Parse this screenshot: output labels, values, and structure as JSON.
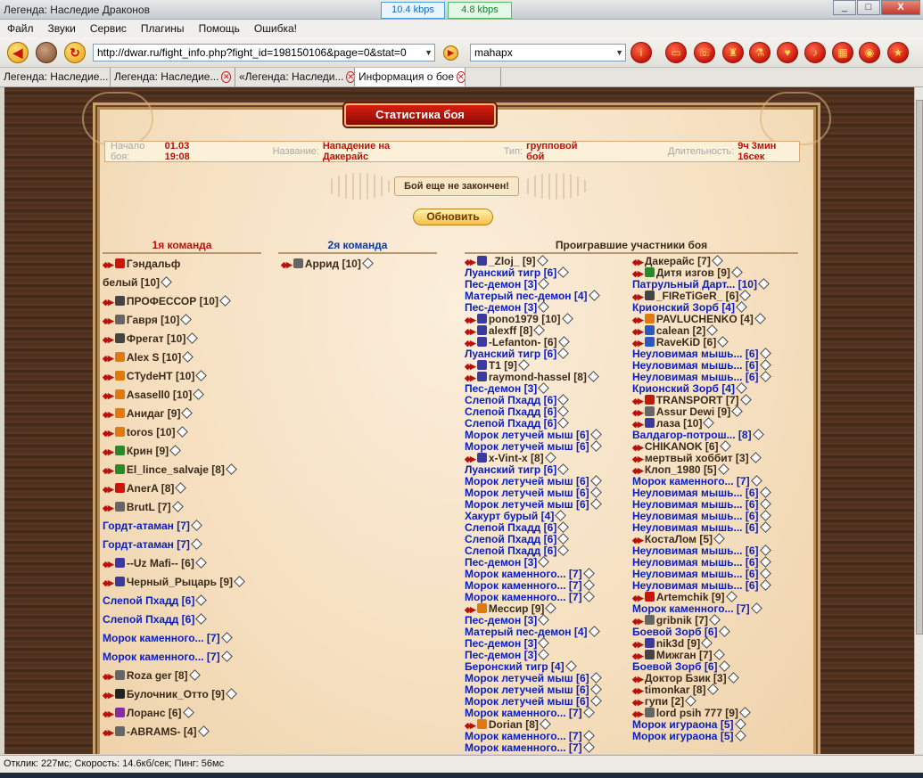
{
  "window": {
    "title": "Легенда: Наследие Драконов",
    "speed_down": "10.4 kbps",
    "speed_up": "4.8 kbps",
    "min": "_",
    "max": "□",
    "close": "X"
  },
  "menu": [
    "Файл",
    "Звуки",
    "Сервис",
    "Плагины",
    "Помощь",
    "Ошибка!"
  ],
  "toolbar": {
    "url": "http://dwar.ru/fight_info.php?fight_id=198150106&page=0&stat=0",
    "search": "mahapx"
  },
  "tabs": [
    {
      "label": "Легенда: Наследие..."
    },
    {
      "label": "Легенда: Наследие..."
    },
    {
      "label": "«Легенда: Наследи..."
    },
    {
      "label": "Информация о бое"
    }
  ],
  "page": {
    "header": "Статистика боя",
    "start_label": "Начало боя:",
    "start_value": "01.03 19:08",
    "name_label": "Название:",
    "name_value": "Нападение на Дакерайс",
    "type_label": "Тип:",
    "type_value": "групповой бой",
    "duration_label": "Длительность:",
    "duration_value": "9ч 3мин 16сек",
    "notice": "Бой еще не закончен!",
    "refresh": "Обновить",
    "team1_title": "1я команда",
    "team2_title": "2я команда",
    "lost_title": "Проигравшие участники боя"
  },
  "team1": [
    {
      "name": "Гэндальф",
      "level": "",
      "ic": "#c8160a"
    },
    {
      "name": "белый",
      "level": "[10]",
      "ic": ""
    },
    {
      "name": "ПРОФЕССОР",
      "level": "[10]",
      "ic": "#444"
    },
    {
      "name": "Гавря",
      "level": "[10]",
      "ic": "#666"
    },
    {
      "name": "Фрегат",
      "level": "[10]",
      "ic": "#444"
    },
    {
      "name": "Alex S",
      "level": "[10]",
      "ic": "#e07a10"
    },
    {
      "name": "CTydeHT",
      "level": "[10]",
      "ic": "#e07a10"
    },
    {
      "name": "Asasell0",
      "level": "[10]",
      "ic": "#e07a10"
    },
    {
      "name": "Анидаг",
      "level": "[9]",
      "ic": "#e07a10"
    },
    {
      "name": "toros",
      "level": "[10]",
      "ic": "#e07a10"
    },
    {
      "name": "Крин",
      "level": "[9]",
      "ic": "#2a8a2a"
    },
    {
      "name": "El_lince_salvaje",
      "level": "[8]",
      "ic": "#2a8a2a"
    },
    {
      "name": "AnerA",
      "level": "[8]",
      "ic": "#c8160a"
    },
    {
      "name": "BrutL",
      "level": "[7]",
      "ic": "#666"
    },
    {
      "name": "Гордт-атаман",
      "level": "[7]",
      "ic": "",
      "mob": true
    },
    {
      "name": "Гордт-атаман",
      "level": "[7]",
      "ic": "",
      "mob": true
    },
    {
      "name": "--Uz Mafi--",
      "level": "[6]",
      "ic": "#3a3aa0"
    },
    {
      "name": "Черный_Рыцарь",
      "level": "[9]",
      "ic": "#3a3aa0"
    },
    {
      "name": "Слепой Пхадд",
      "level": "[6]",
      "ic": "",
      "mob": true
    },
    {
      "name": "Слепой Пхадд",
      "level": "[6]",
      "ic": "",
      "mob": true
    },
    {
      "name": "Морок каменного...",
      "level": "[7]",
      "ic": "",
      "mob": true
    },
    {
      "name": "Морок каменного...",
      "level": "[7]",
      "ic": "",
      "mob": true
    },
    {
      "name": "Roza ger",
      "level": "[8]",
      "ic": "#666"
    },
    {
      "name": "Булочник_Отто",
      "level": "[9]",
      "ic": "#222"
    },
    {
      "name": "Лоранс",
      "level": "[6]",
      "ic": "#8a2aa0"
    },
    {
      "name": "-ABRAMS-",
      "level": "[4]",
      "ic": "#666"
    }
  ],
  "team2": [
    {
      "name": "Аррид",
      "level": "[10]",
      "ic": "#666"
    }
  ],
  "lost_left": [
    {
      "name": "_Zloj_",
      "level": "[9]",
      "ic": "#3a3aa0"
    },
    {
      "name": "Луанский тигр",
      "level": "[6]",
      "mob": true
    },
    {
      "name": "Пес-демон",
      "level": "[3]",
      "mob": true
    },
    {
      "name": "Матерый пес-демон",
      "level": "[4]",
      "mob": true
    },
    {
      "name": "Пес-демон",
      "level": "[3]",
      "mob": true
    },
    {
      "name": "pono1979",
      "level": "[10]",
      "ic": "#3a3aa0"
    },
    {
      "name": "alexff",
      "level": "[8]",
      "ic": "#3a3aa0"
    },
    {
      "name": "-Lefanton-",
      "level": "[6]",
      "ic": "#3a3aa0"
    },
    {
      "name": "Луанский тигр",
      "level": "[6]",
      "mob": true
    },
    {
      "name": "T1",
      "level": "[9]",
      "ic": "#3a3aa0"
    },
    {
      "name": "raymond-hassel",
      "level": "[8]",
      "ic": "#3a3aa0"
    },
    {
      "name": "Пес-демон",
      "level": "[3]",
      "mob": true
    },
    {
      "name": "Слепой Пхадд",
      "level": "[6]",
      "mob": true
    },
    {
      "name": "Слепой Пхадд",
      "level": "[6]",
      "mob": true
    },
    {
      "name": "Слепой Пхадд",
      "level": "[6]",
      "mob": true
    },
    {
      "name": "Морок летучей мыш",
      "level": "[6]",
      "mob": true
    },
    {
      "name": "Морок летучей мыш",
      "level": "[6]",
      "mob": true
    },
    {
      "name": "x-Vint-x",
      "level": "[8]",
      "ic": "#3a3aa0"
    },
    {
      "name": "Луанский тигр",
      "level": "[6]",
      "mob": true
    },
    {
      "name": "Морок летучей мыш",
      "level": "[6]",
      "mob": true
    },
    {
      "name": "Морок летучей мыш",
      "level": "[6]",
      "mob": true
    },
    {
      "name": "Морок летучей мыш",
      "level": "[6]",
      "mob": true
    },
    {
      "name": "Хакурт бурый",
      "level": "[4]",
      "mob": true
    },
    {
      "name": "Слепой Пхадд",
      "level": "[6]",
      "mob": true
    },
    {
      "name": "Слепой Пхадд",
      "level": "[6]",
      "mob": true
    },
    {
      "name": "Слепой Пхадд",
      "level": "[6]",
      "mob": true
    },
    {
      "name": "Пес-демон",
      "level": "[3]",
      "mob": true
    },
    {
      "name": "Морок каменного...",
      "level": "[7]",
      "mob": true
    },
    {
      "name": "Морок каменного...",
      "level": "[7]",
      "mob": true
    },
    {
      "name": "Морок каменного...",
      "level": "[7]",
      "mob": true
    },
    {
      "name": "Мессир",
      "level": "[9]",
      "ic": "#e07a10"
    },
    {
      "name": "Пес-демон",
      "level": "[3]",
      "mob": true
    },
    {
      "name": "Матерый пес-демон",
      "level": "[4]",
      "mob": true
    },
    {
      "name": "Пес-демон",
      "level": "[3]",
      "mob": true
    },
    {
      "name": "Пес-демон",
      "level": "[3]",
      "mob": true
    },
    {
      "name": "Беронский тигр",
      "level": "[4]",
      "mob": true
    },
    {
      "name": "Морок летучей мыш",
      "level": "[6]",
      "mob": true
    },
    {
      "name": "Морок летучей мыш",
      "level": "[6]",
      "mob": true
    },
    {
      "name": "Морок летучей мыш",
      "level": "[6]",
      "mob": true
    },
    {
      "name": "Морок каменного...",
      "level": "[7]",
      "mob": true
    },
    {
      "name": "Dorian",
      "level": "[8]",
      "ic": "#e07a10"
    },
    {
      "name": "Морок каменного...",
      "level": "[7]",
      "mob": true
    },
    {
      "name": "Морок каменного...",
      "level": "[7]",
      "mob": true
    }
  ],
  "lost_right": [
    {
      "name": "Дакерайс",
      "level": "[7]",
      "ic": ""
    },
    {
      "name": "Дитя изгов",
      "level": "[9]",
      "ic": "#2a8a2a"
    },
    {
      "name": "Патрульный Дарт...",
      "level": "[10]",
      "mob": true
    },
    {
      "name": "_FIReTiGeR_",
      "level": "[6]",
      "ic": "#444"
    },
    {
      "name": "Крионский Зорб",
      "level": "[4]",
      "mob": true
    },
    {
      "name": "PAVLUCHENKO",
      "level": "[4]",
      "ic": "#e07a10"
    },
    {
      "name": "calean",
      "level": "[2]",
      "ic": "#2a5ac0"
    },
    {
      "name": "RaveKiD",
      "level": "[6]",
      "ic": "#2a5ac0"
    },
    {
      "name": "Неуловимая мышь...",
      "level": "[6]",
      "mob": true
    },
    {
      "name": "Неуловимая мышь...",
      "level": "[6]",
      "mob": true
    },
    {
      "name": "Неуловимая мышь...",
      "level": "[6]",
      "mob": true
    },
    {
      "name": "Крионский Зорб",
      "level": "[4]",
      "mob": true
    },
    {
      "name": "TRANSPORT",
      "level": "[7]",
      "ic": "#c8160a"
    },
    {
      "name": "Assur Dewi",
      "level": "[9]",
      "ic": "#666"
    },
    {
      "name": "лаза",
      "level": "[10]",
      "ic": "#3a3aa0"
    },
    {
      "name": "Валдагор-потрош...",
      "level": "[8]",
      "mob": true
    },
    {
      "name": "CHIKANOK",
      "level": "[6]",
      "ic": ""
    },
    {
      "name": "мертвый хоббит",
      "level": "[3]",
      "ic": ""
    },
    {
      "name": "Клоп_1980",
      "level": "[5]",
      "ic": ""
    },
    {
      "name": "Морок каменного...",
      "level": "[7]",
      "mob": true
    },
    {
      "name": "Неуловимая мышь...",
      "level": "[6]",
      "mob": true
    },
    {
      "name": "Неуловимая мышь...",
      "level": "[6]",
      "mob": true
    },
    {
      "name": "Неуловимая мышь...",
      "level": "[6]",
      "mob": true
    },
    {
      "name": "Неуловимая мышь...",
      "level": "[6]",
      "mob": true
    },
    {
      "name": "КостаЛом",
      "level": "[5]",
      "ic": ""
    },
    {
      "name": "Неуловимая мышь...",
      "level": "[6]",
      "mob": true
    },
    {
      "name": "Неуловимая мышь...",
      "level": "[6]",
      "mob": true
    },
    {
      "name": "Неуловимая мышь...",
      "level": "[6]",
      "mob": true
    },
    {
      "name": "Неуловимая мышь...",
      "level": "[6]",
      "mob": true
    },
    {
      "name": "Artemchik",
      "level": "[9]",
      "ic": "#c8160a"
    },
    {
      "name": "Морок каменного...",
      "level": "[7]",
      "mob": true
    },
    {
      "name": "gribnik",
      "level": "[7]",
      "ic": "#666"
    },
    {
      "name": "Боевой Зорб",
      "level": "[6]",
      "mob": true
    },
    {
      "name": "nik3d",
      "level": "[9]",
      "ic": "#3a3aa0"
    },
    {
      "name": "Мижган",
      "level": "[7]",
      "ic": "#444"
    },
    {
      "name": "Боевой Зорб",
      "level": "[6]",
      "mob": true
    },
    {
      "name": "Доктор Бзик",
      "level": "[3]",
      "ic": ""
    },
    {
      "name": "timonkar",
      "level": "[8]",
      "ic": ""
    },
    {
      "name": "гупи",
      "level": "[2]",
      "ic": ""
    },
    {
      "name": "lord psih 777",
      "level": "[9]",
      "ic": "#666"
    },
    {
      "name": "Морок игураона",
      "level": "[5]",
      "mob": true
    },
    {
      "name": "Морок игураона",
      "level": "[5]",
      "mob": true
    }
  ],
  "status": "Отклик: 227мс; Скорость: 14.6кб/сек; Пинг: 56мс"
}
